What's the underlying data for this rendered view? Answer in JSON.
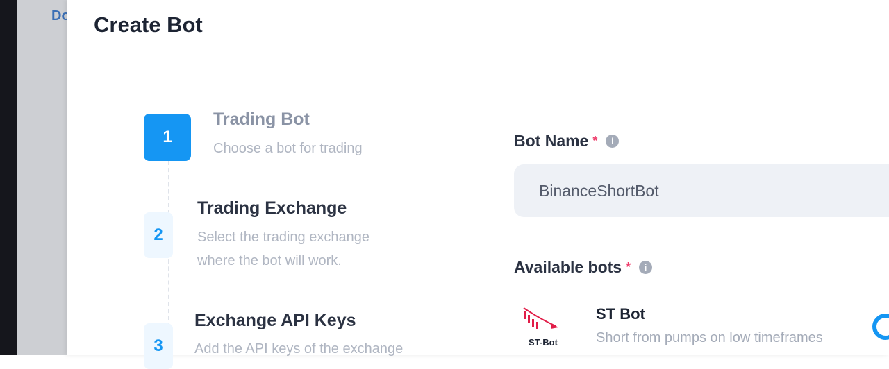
{
  "backdrop": {
    "link_text": "Do"
  },
  "modal": {
    "title": "Create Bot"
  },
  "steps": [
    {
      "number": "1",
      "title": "Trading Bot",
      "desc": [
        "Choose a bot for trading"
      ]
    },
    {
      "number": "2",
      "title": "Trading Exchange",
      "desc": [
        "Select the trading exchange",
        "where the bot will work."
      ]
    },
    {
      "number": "3",
      "title": "Exchange API Keys",
      "desc": [
        "Add the API keys of the exchange"
      ]
    }
  ],
  "form": {
    "bot_name": {
      "label": "Bot Name",
      "required_mark": "*",
      "value": "BinanceShortBot"
    },
    "available_bots": {
      "label": "Available bots",
      "required_mark": "*"
    },
    "bots": [
      {
        "logo_text": "ST-Bot",
        "name": "ST Bot",
        "desc": "Short from pumps on low timeframes"
      }
    ]
  },
  "icons": {
    "info": "info-icon",
    "bot_logo": "down-trend-chart-icon"
  },
  "colors": {
    "accent": "#1596f3",
    "required": "#ee3b6a"
  }
}
